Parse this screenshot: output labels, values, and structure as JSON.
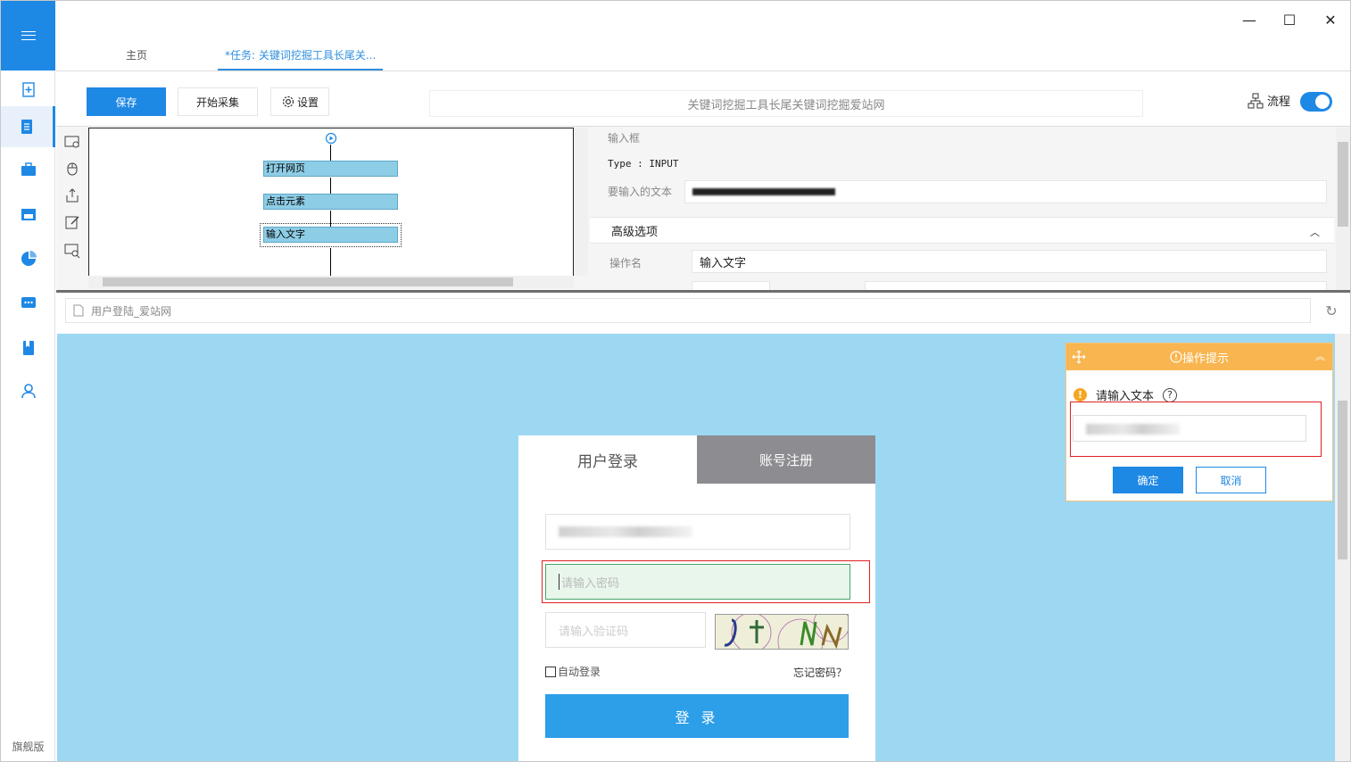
{
  "window": {
    "minimize": "—",
    "maximize": "☐",
    "close": "✕"
  },
  "tabs": [
    {
      "label": "主页"
    },
    {
      "label": "*任务: 关键词挖掘工具长尾关..."
    }
  ],
  "toolbar": {
    "save_label": "保存",
    "start_label": "开始采集",
    "settings_label": "设置",
    "task_title": "关键词挖掘工具长尾关键词挖掘爱站网",
    "flow_label": "流程"
  },
  "flow": {
    "nodes": [
      "打开网页",
      "点击元素",
      "输入文字"
    ]
  },
  "properties": {
    "section_title": "输入框",
    "type_text": "Type : INPUT",
    "text_label": "要输入的文本",
    "advanced_label": "高级选项",
    "opname_label": "操作名",
    "opname_value": "输入文字"
  },
  "address": {
    "page_title": "用户登陆_爱站网"
  },
  "login": {
    "tab_login": "用户登录",
    "tab_register": "账号注册",
    "password_placeholder": "请输入密码",
    "captcha_placeholder": "请输入验证码",
    "auto_login": "自动登录",
    "forgot": "忘记密码？",
    "login_button": "登 录"
  },
  "hint": {
    "title": "操作提示",
    "prompt": "请输入文本",
    "ok": "确定",
    "cancel": "取消"
  },
  "sidebar": {
    "edition": "旗舰版"
  },
  "colors": {
    "accent": "#1e88e5",
    "hint_header": "#f8b550",
    "viewport_bg": "#9dd8f2"
  }
}
